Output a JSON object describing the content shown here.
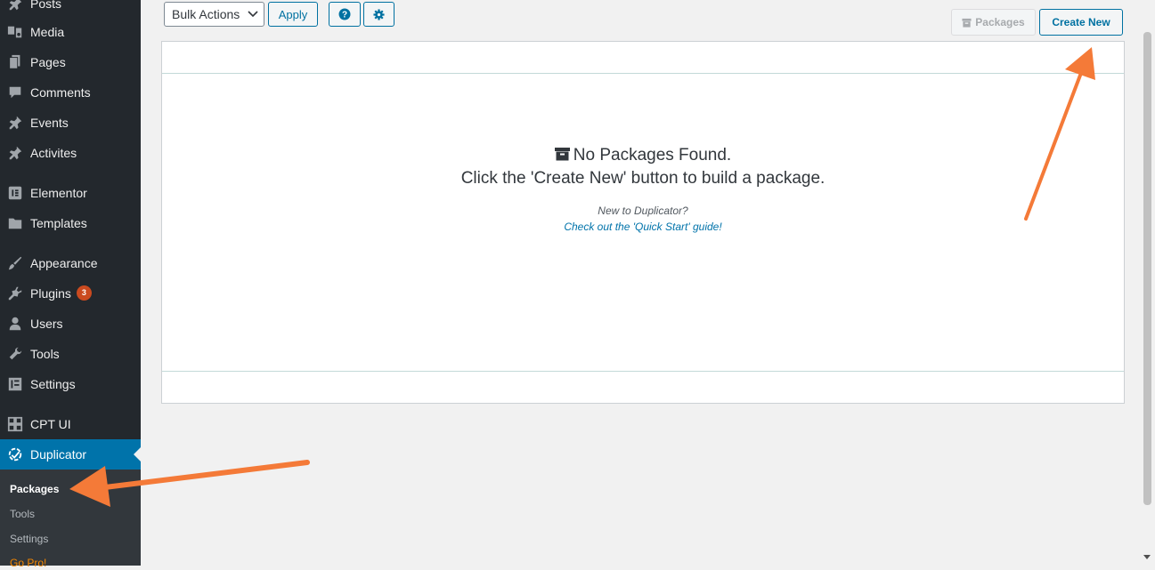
{
  "sidebar": {
    "items": [
      {
        "label": "Posts",
        "icon": "pin-icon"
      },
      {
        "label": "Media",
        "icon": "media-icon"
      },
      {
        "label": "Pages",
        "icon": "pages-icon"
      },
      {
        "label": "Comments",
        "icon": "comment-icon"
      },
      {
        "label": "Events",
        "icon": "pin-icon"
      },
      {
        "label": "Activites",
        "icon": "pin-icon"
      },
      {
        "label": "Elementor",
        "icon": "elementor-icon"
      },
      {
        "label": "Templates",
        "icon": "folder-icon"
      },
      {
        "label": "Appearance",
        "icon": "brush-icon"
      },
      {
        "label": "Plugins",
        "icon": "plug-icon",
        "badge": "3"
      },
      {
        "label": "Users",
        "icon": "user-icon"
      },
      {
        "label": "Tools",
        "icon": "wrench-icon"
      },
      {
        "label": "Settings",
        "icon": "settings-icon"
      },
      {
        "label": "CPT UI",
        "icon": "grid-icon"
      },
      {
        "label": "Duplicator",
        "icon": "duplicator-icon",
        "active": true
      }
    ],
    "submenu": [
      {
        "label": "Packages",
        "current": true
      },
      {
        "label": "Tools"
      },
      {
        "label": "Settings"
      },
      {
        "label": "Go Pro!"
      }
    ]
  },
  "toolbar": {
    "bulk_actions": "Bulk Actions",
    "apply": "Apply",
    "help_icon": "question-icon",
    "settings_icon": "gear-icon",
    "packages": "Packages",
    "create_new": "Create New"
  },
  "empty_state": {
    "icon": "archive-icon",
    "title": "No Packages Found.",
    "subtitle": "Click the 'Create New' button to build a package.",
    "new_to": "New to Duplicator?",
    "quick_start": "Check out the 'Quick Start' guide!"
  },
  "colors": {
    "sidebar_bg": "#23282d",
    "active_bg": "#0073aa",
    "accent": "#0071a1",
    "arrow": "#f47a38",
    "badge": "#ca4a1f"
  }
}
